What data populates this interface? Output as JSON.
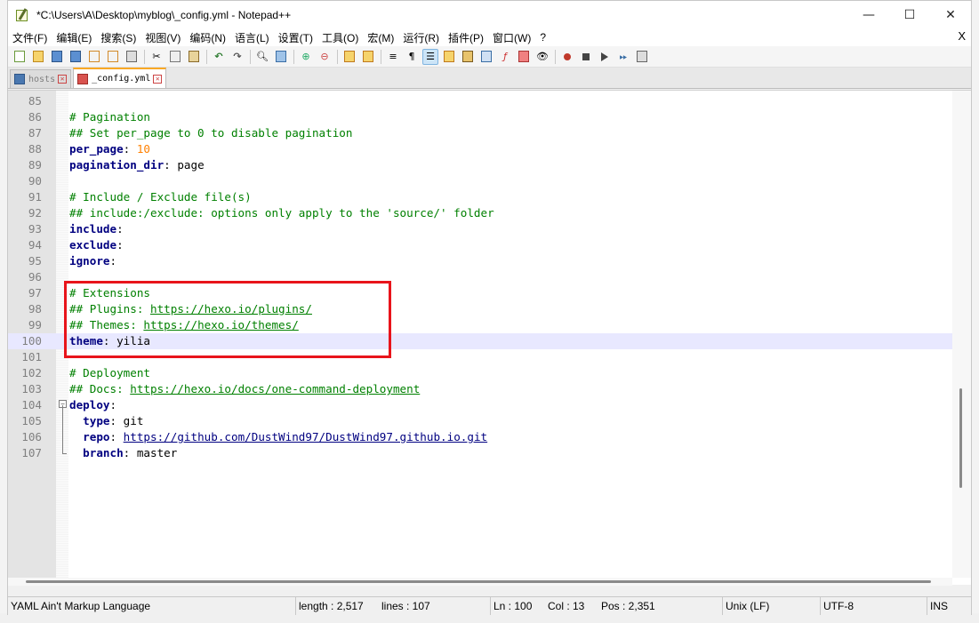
{
  "window": {
    "title": "*C:\\Users\\A\\Desktop\\myblog\\_config.yml - Notepad++",
    "min_glyph": "—",
    "max_glyph": "☐",
    "close_glyph": "✕"
  },
  "menu": {
    "items": [
      "文件(F)",
      "编辑(E)",
      "搜索(S)",
      "视图(V)",
      "编码(N)",
      "语言(L)",
      "设置(T)",
      "工具(O)",
      "宏(M)",
      "运行(R)",
      "插件(P)",
      "窗口(W)",
      "?"
    ],
    "close_label": "X"
  },
  "toolbar": {
    "icons": [
      "new-file-icon",
      "open-file-icon",
      "save-icon",
      "save-all-icon",
      "close-icon",
      "close-all-icon",
      "print-icon",
      "cut-icon",
      "copy-icon",
      "paste-icon",
      "undo-icon",
      "redo-icon",
      "find-icon",
      "replace-icon",
      "zoom-in-icon",
      "zoom-out-icon",
      "sync-v-icon",
      "sync-h-icon",
      "word-wrap-icon",
      "show-all-chars-icon",
      "indent-guide-icon",
      "udl-icon",
      "doc-map-icon",
      "doc-list-icon",
      "function-list-icon",
      "folder-workspace-icon",
      "monitoring-icon",
      "record-macro-icon",
      "stop-macro-icon",
      "play-macro-icon",
      "run-macro-multiple-icon",
      "save-macro-icon"
    ]
  },
  "tabs": [
    {
      "label": "hosts",
      "active": false,
      "icon": "saved-file-icon"
    },
    {
      "label": "_config.yml",
      "active": true,
      "icon": "modified-file-icon"
    }
  ],
  "editor": {
    "lines": [
      {
        "n": "85",
        "parts": []
      },
      {
        "n": "86",
        "parts": [
          {
            "t": "# Pagination",
            "c": "c-comment"
          }
        ]
      },
      {
        "n": "87",
        "parts": [
          {
            "t": "## Set per_page to 0 to disable pagination",
            "c": "c-comment"
          }
        ]
      },
      {
        "n": "88",
        "parts": [
          {
            "t": "per_page",
            "c": "c-key"
          },
          {
            "t": ": ",
            "c": ""
          },
          {
            "t": "10",
            "c": "c-num"
          }
        ]
      },
      {
        "n": "89",
        "parts": [
          {
            "t": "pagination_dir",
            "c": "c-key"
          },
          {
            "t": ": page",
            "c": ""
          }
        ]
      },
      {
        "n": "90",
        "parts": []
      },
      {
        "n": "91",
        "parts": [
          {
            "t": "# Include / Exclude file(s)",
            "c": "c-comment"
          }
        ]
      },
      {
        "n": "92",
        "parts": [
          {
            "t": "## include:/exclude: options only apply to the 'source/' folder",
            "c": "c-comment"
          }
        ]
      },
      {
        "n": "93",
        "parts": [
          {
            "t": "include",
            "c": "c-key"
          },
          {
            "t": ":",
            "c": ""
          }
        ]
      },
      {
        "n": "94",
        "parts": [
          {
            "t": "exclude",
            "c": "c-key"
          },
          {
            "t": ":",
            "c": ""
          }
        ]
      },
      {
        "n": "95",
        "parts": [
          {
            "t": "ignore",
            "c": "c-key"
          },
          {
            "t": ":",
            "c": ""
          }
        ]
      },
      {
        "n": "96",
        "parts": []
      },
      {
        "n": "97",
        "parts": [
          {
            "t": "# Extensions",
            "c": "c-comment"
          }
        ]
      },
      {
        "n": "98",
        "parts": [
          {
            "t": "## Plugins: ",
            "c": "c-comment"
          },
          {
            "t": "https://hexo.io/plugins/",
            "c": "c-url"
          }
        ]
      },
      {
        "n": "99",
        "parts": [
          {
            "t": "## Themes: ",
            "c": "c-comment"
          },
          {
            "t": "https://hexo.io/themes/",
            "c": "c-url"
          }
        ]
      },
      {
        "n": "100",
        "parts": [
          {
            "t": "theme",
            "c": "c-key"
          },
          {
            "t": ": yilia",
            "c": ""
          }
        ],
        "current": true
      },
      {
        "n": "101",
        "parts": []
      },
      {
        "n": "102",
        "parts": [
          {
            "t": "# Deployment",
            "c": "c-comment"
          }
        ]
      },
      {
        "n": "103",
        "parts": [
          {
            "t": "## Docs: ",
            "c": "c-comment"
          },
          {
            "t": "https://hexo.io/docs/one-command-deployment",
            "c": "c-url"
          }
        ]
      },
      {
        "n": "104",
        "parts": [
          {
            "t": "deploy",
            "c": "c-key"
          },
          {
            "t": ":",
            "c": ""
          }
        ]
      },
      {
        "n": "105",
        "parts": [
          {
            "t": "  type",
            "c": "c-key"
          },
          {
            "t": ": git",
            "c": ""
          }
        ]
      },
      {
        "n": "106",
        "parts": [
          {
            "t": "  repo",
            "c": "c-key"
          },
          {
            "t": ": ",
            "c": ""
          },
          {
            "t": "https://github.com/DustWind97/DustWind97.github.io.git",
            "c": "c-urlk"
          }
        ]
      },
      {
        "n": "107",
        "parts": [
          {
            "t": "  branch",
            "c": "c-key"
          },
          {
            "t": ": master",
            "c": ""
          }
        ]
      }
    ]
  },
  "status": {
    "language": "YAML Ain't Markup Language",
    "length": "length : 2,517",
    "lines": "lines : 107",
    "ln": "Ln : 100",
    "col": "Col : 13",
    "pos": "Pos : 2,351",
    "eol": "Unix (LF)",
    "encoding": "UTF-8",
    "mode": "INS"
  },
  "colors": {
    "highlight_box": "#e8141b",
    "comment": "#008000",
    "keyword": "#000080",
    "number": "#ff8000",
    "current_line": "#e8e8ff"
  }
}
